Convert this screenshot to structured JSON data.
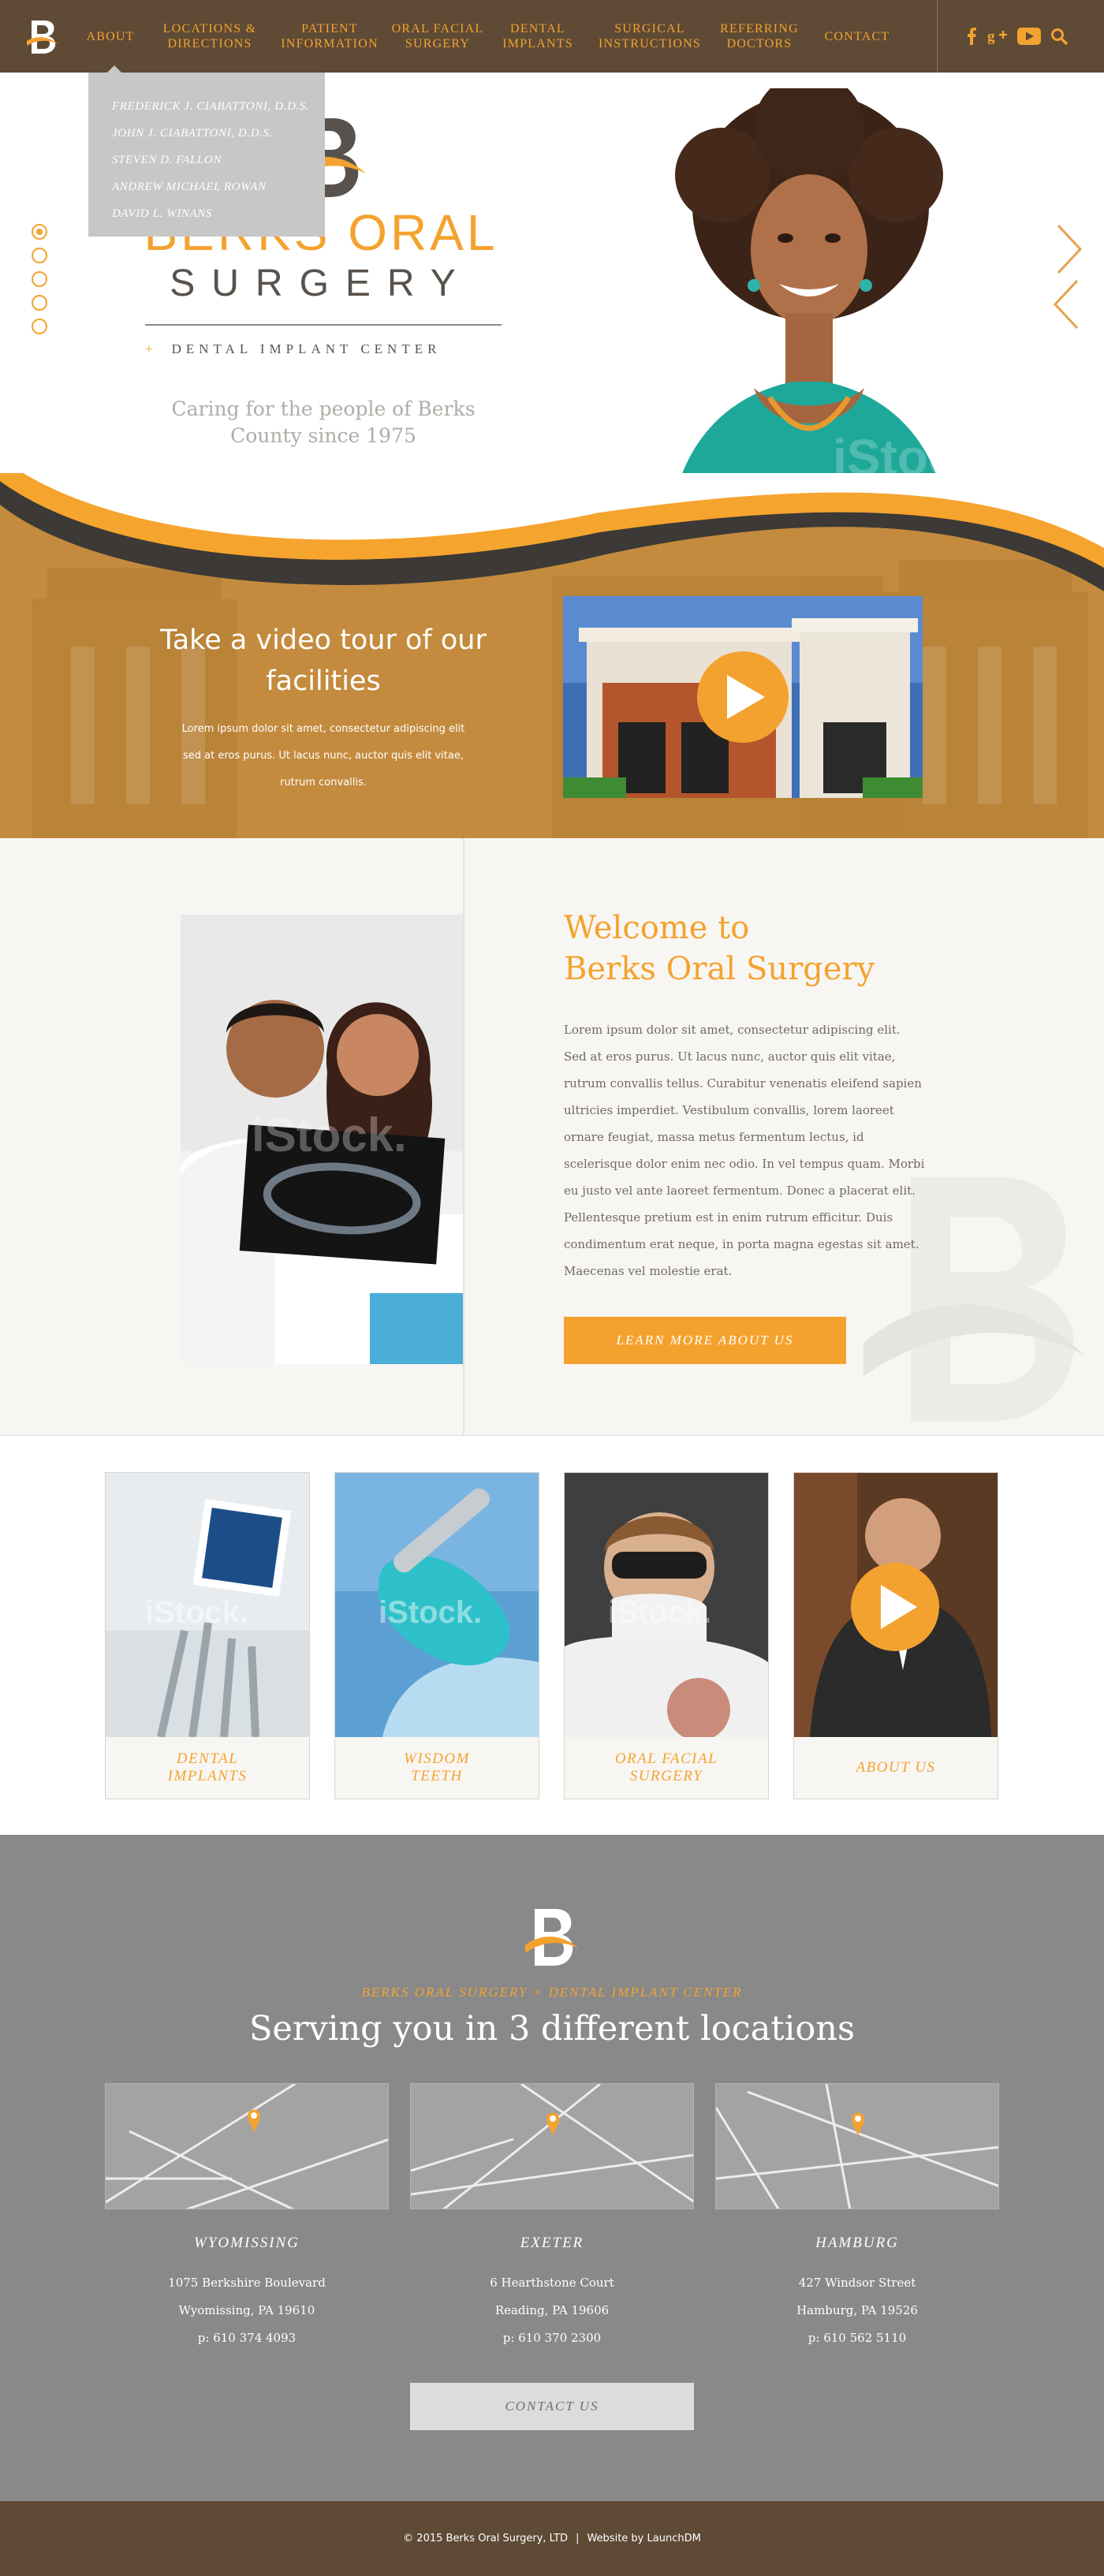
{
  "nav": {
    "logo": "B",
    "items": [
      {
        "label": "ABOUT",
        "active": true
      },
      {
        "label": "LOCATIONS &\nDIRECTIONS"
      },
      {
        "label": "PATIENT\nINFORMATION"
      },
      {
        "label": "ORAL FACIAL\nSURGERY"
      },
      {
        "label": "DENTAL\nIMPLANTS"
      },
      {
        "label": "SURGICAL\nINSTRUCTIONS"
      },
      {
        "label": "REFERRING\nDOCTORS"
      },
      {
        "label": "CONTACT"
      }
    ],
    "social": [
      "facebook-icon",
      "google-plus-icon",
      "youtube-icon",
      "search-icon"
    ],
    "dropdown": [
      "FREDERICK J. CIABATTONI, D.D.S.",
      "JOHN J. CIABATTONI, D.D.S.",
      "STEVEN D. FALLON",
      "ANDREW MICHAEL ROWAN",
      "DAVID L. WINANS"
    ]
  },
  "hero": {
    "brand_line1": "BERKS ORAL",
    "brand_line2": "SURGERY",
    "brand_plus": "+",
    "brand_sub": "DENTAL IMPLANT CENTER",
    "tagline": "Caring for the people of Berks County since 1975",
    "slides": 5,
    "active_slide": 1
  },
  "tour": {
    "title": "Take a video tour of our facilities",
    "text": "Lorem ipsum dolor sit amet, consectetur adipiscing elit sed at eros purus. Ut lacus nunc, auctor quis elit vitae, rutrum convallis."
  },
  "welcome": {
    "title_line1": "Welcome to",
    "title_line2": "Berks Oral Surgery",
    "body": "Lorem ipsum dolor sit amet, consectetur adipiscing elit. Sed at eros purus. Ut lacus nunc, auctor quis elit vitae, rutrum convallis tellus. Curabitur venenatis eleifend sapien ultricies imperdiet. Vestibulum convallis, lorem laoreet ornare feugiat, massa metus fermentum lectus, id scelerisque dolor enim nec odio. In vel tempus quam. Morbi eu justo vel ante laoreet fermentum. Donec a placerat elit. Pellentesque pretium est in enim rutrum efficitur. Duis condimentum erat neque, in porta magna egestas sit amet. Maecenas vel molestie erat.",
    "button": "LEARN MORE ABOUT US"
  },
  "services": [
    {
      "label": "DENTAL\nIMPLANTS"
    },
    {
      "label": "WISDOM\nTEETH"
    },
    {
      "label": "ORAL FACIAL\nSURGERY"
    },
    {
      "label": "ABOUT US"
    }
  ],
  "locations": {
    "kicker": "BERKS ORAL SURGERY + DENTAL IMPLANT CENTER",
    "heading": "Serving you in 3 different locations",
    "items": [
      {
        "name": "WYOMISSING",
        "address": "1075 Berkshire Boulevard",
        "city": "Wyomissing, PA 19610",
        "phone": "p: 610 374 4093"
      },
      {
        "name": "EXETER",
        "address": "6 Hearthstone Court",
        "city": "Reading, PA 19606",
        "phone": "p: 610 370 2300"
      },
      {
        "name": "HAMBURG",
        "address": "427 Windsor Street",
        "city": "Hamburg, PA 19526",
        "phone": "p: 610 562 5110"
      }
    ],
    "contact_button": "CONTACT US"
  },
  "footer": {
    "copyright": "© 2015 Berks Oral Surgery, LTD",
    "separator": "|",
    "credit": "Website by LaunchDM"
  },
  "colors": {
    "accent": "#f4a22f",
    "brown": "#5e4a35",
    "gray_section": "#898989",
    "cream": "#f8f6f2"
  }
}
